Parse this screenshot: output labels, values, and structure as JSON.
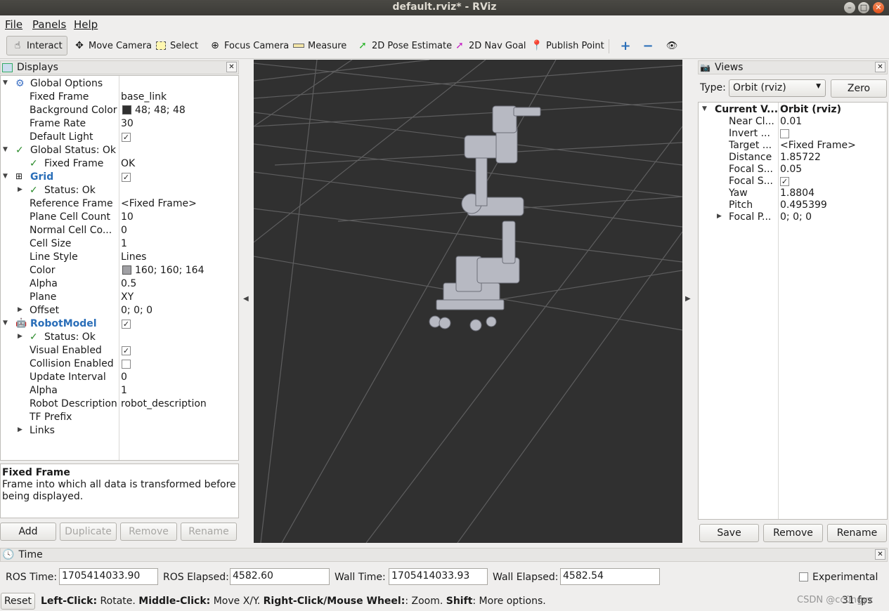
{
  "window": {
    "title": "default.rviz* - RViz"
  },
  "menu": {
    "file": "File",
    "panels": "Panels",
    "help": "Help"
  },
  "toolbar": {
    "interact": "Interact",
    "move_camera": "Move Camera",
    "select": "Select",
    "focus_camera": "Focus Camera",
    "measure": "Measure",
    "pose_estimate": "2D Pose Estimate",
    "nav_goal": "2D Nav Goal",
    "publish_point": "Publish Point"
  },
  "displays": {
    "title": "Displays",
    "rows": {
      "global_options": "Global Options",
      "fixed_frame": {
        "label": "Fixed Frame",
        "value": "base_link"
      },
      "background_color": {
        "label": "Background Color",
        "value": "48; 48; 48",
        "swatch": "#303030"
      },
      "frame_rate": {
        "label": "Frame Rate",
        "value": "30"
      },
      "default_light": {
        "label": "Default Light",
        "checked": true
      },
      "global_status": "Global Status: Ok",
      "fixed_frame_status": {
        "label": "Fixed Frame",
        "value": "OK"
      },
      "grid": "Grid",
      "grid_status": "Status: Ok",
      "reference_frame": {
        "label": "Reference Frame",
        "value": "<Fixed Frame>"
      },
      "plane_cell_count": {
        "label": "Plane Cell Count",
        "value": "10"
      },
      "normal_cell_count": {
        "label": "Normal Cell Co...",
        "value": "0"
      },
      "cell_size": {
        "label": "Cell Size",
        "value": "1"
      },
      "line_style": {
        "label": "Line Style",
        "value": "Lines"
      },
      "color": {
        "label": "Color",
        "value": "160; 160; 164",
        "swatch": "#a0a0a4"
      },
      "alpha": {
        "label": "Alpha",
        "value": "0.5"
      },
      "plane": {
        "label": "Plane",
        "value": "XY"
      },
      "offset": {
        "label": "Offset",
        "value": "0; 0; 0"
      },
      "robot_model": "RobotModel",
      "robot_status": "Status: Ok",
      "visual_enabled": {
        "label": "Visual Enabled"
      },
      "collision_enabled": {
        "label": "Collision Enabled"
      },
      "update_interval": {
        "label": "Update Interval",
        "value": "0"
      },
      "robot_alpha": {
        "label": "Alpha",
        "value": "1"
      },
      "robot_description": {
        "label": "Robot Description",
        "value": "robot_description"
      },
      "tf_prefix": {
        "label": "TF Prefix"
      },
      "links": {
        "label": "Links"
      }
    },
    "help_title": "Fixed Frame",
    "help_text": "Frame into which all data is transformed before being displayed.",
    "buttons": {
      "add": "Add",
      "duplicate": "Duplicate",
      "remove": "Remove",
      "rename": "Rename"
    }
  },
  "views": {
    "title": "Views",
    "type_label": "Type:",
    "type_value": "Orbit (rviz)",
    "zero": "Zero",
    "rows": {
      "current": {
        "label": "Current V...",
        "value": "Orbit (rviz)"
      },
      "near_clip": {
        "label": "Near Cl...",
        "value": "0.01"
      },
      "invert": {
        "label": "Invert ..."
      },
      "target": {
        "label": "Target ...",
        "value": "<Fixed Frame>"
      },
      "distance": {
        "label": "Distance",
        "value": "1.85722"
      },
      "focal_scale": {
        "label": "Focal S...",
        "value": "0.05"
      },
      "focal_shape": {
        "label": "Focal S..."
      },
      "yaw": {
        "label": "Yaw",
        "value": "1.8804"
      },
      "pitch": {
        "label": "Pitch",
        "value": "0.495399"
      },
      "focal_point": {
        "label": "Focal P...",
        "value": "0; 0; 0"
      }
    },
    "buttons": {
      "save": "Save",
      "remove": "Remove",
      "rename": "Rename"
    }
  },
  "time": {
    "title": "Time",
    "ros_time_label": "ROS Time:",
    "ros_time": "1705414033.90",
    "ros_elapsed_label": "ROS Elapsed:",
    "ros_elapsed": "4582.60",
    "wall_time_label": "Wall Time:",
    "wall_time": "1705414033.93",
    "wall_elapsed_label": "Wall Elapsed:",
    "wall_elapsed": "4582.54",
    "experimental": "Experimental"
  },
  "status": {
    "reset": "Reset",
    "k1": "Left-Click:",
    "t1": " Rotate. ",
    "k2": "Middle-Click:",
    "t2": " Move X/Y. ",
    "k3": "Right-Click/Mouse Wheel:",
    "t3": ": Zoom. ",
    "k4": "Shift",
    "t4": ": More options.",
    "fps": "31 fps",
    "watermark": "CSDN @cc0ngyx"
  }
}
